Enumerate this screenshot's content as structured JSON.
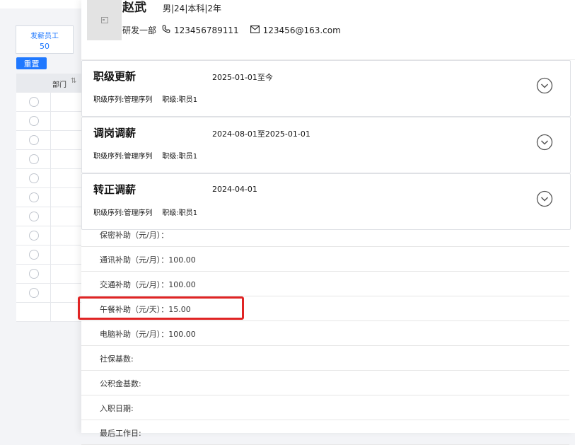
{
  "stats": {
    "label": "发薪员工",
    "value": "50"
  },
  "toolbar": {
    "reset_label": "重置"
  },
  "table": {
    "column": "部门",
    "row_count": 11
  },
  "profile": {
    "name": "赵武",
    "meta": "男|24|本科|2年",
    "department": "研发一部",
    "phone": "123456789111",
    "email": "123456@163.com"
  },
  "history": [
    {
      "title": "职级更新",
      "date": "2025-01-01至今",
      "series_label": "职级序列:",
      "series": "管理序列",
      "rank_label": "职级:",
      "rank": "职员1"
    },
    {
      "title": "调岗调薪",
      "date": "2024-08-01至2025-01-01",
      "series_label": "职级序列:",
      "series": "管理序列",
      "rank_label": "职级:",
      "rank": "职员1"
    },
    {
      "title": "转正调薪",
      "date": "2024-04-01",
      "series_label": "职级序列:",
      "series": "管理序列",
      "rank_label": "职级:",
      "rank": "职员1"
    }
  ],
  "details": [
    "保密补助（元/月）：",
    "通讯补助（元/月）：100.00",
    "交通补助（元/月）：100.00",
    "午餐补助（元/天）：15.00",
    "电脑补助（元/月）：100.00",
    "社保基数:",
    "公积金基数:",
    "入职日期:",
    "最后工作日:"
  ],
  "colors": {
    "accent": "#1f78ff",
    "highlight": "#e02424"
  },
  "icons": {
    "phone": "phone-icon",
    "mail": "mail-icon",
    "expand": "chevron-down-circle-icon",
    "sort": "sort-icon"
  }
}
